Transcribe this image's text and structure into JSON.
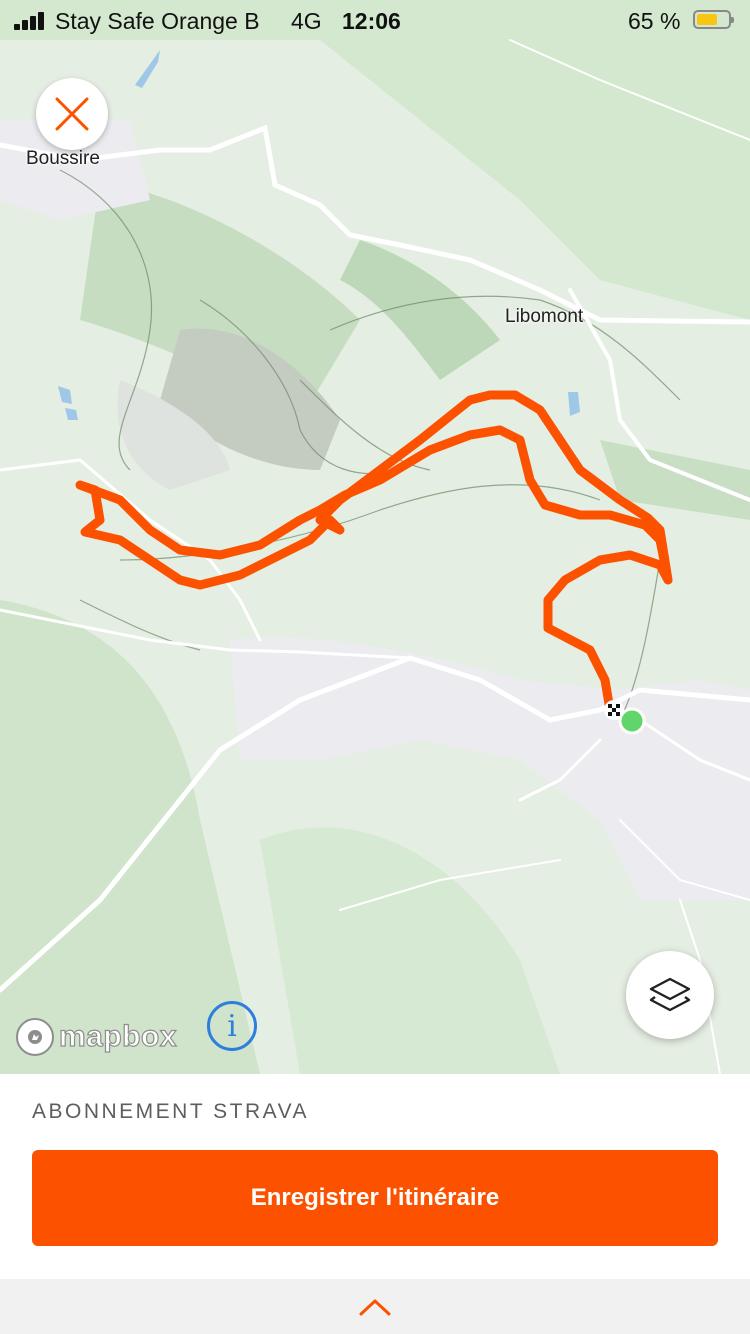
{
  "status_bar": {
    "carrier": "Stay Safe Orange B",
    "network": "4G",
    "time": "12:06",
    "battery_percent": "65 %",
    "battery_level": 0.65
  },
  "map": {
    "places": [
      "Boussire",
      "Libomont"
    ],
    "attribution": "mapbox",
    "route_color": "#fc5200"
  },
  "buttons": {
    "close_icon": "close-icon",
    "layers_icon": "layers-icon",
    "info_glyph": "i"
  },
  "panel": {
    "subscription_label": "ABONNEMENT STRAVA",
    "save_route_label": "Enregistrer l'itinéraire",
    "accent_color": "#fc5200",
    "expand_icon": "chevron-up-icon"
  }
}
